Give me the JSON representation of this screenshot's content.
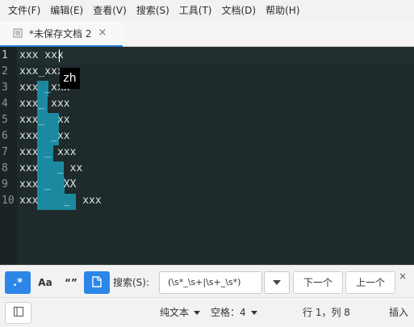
{
  "menu": [
    "文件(F)",
    "编辑(E)",
    "查看(V)",
    "搜索(S)",
    "工具(T)",
    "文档(D)",
    "帮助(H)"
  ],
  "tab": {
    "label": "*未保存文档 2",
    "close": "×"
  },
  "editor": {
    "line_numbers": [
      "1",
      "2",
      "3",
      "4",
      "5",
      "6",
      "7",
      "8",
      "9",
      "10"
    ],
    "lines": [
      "xxx xxx",
      "xxx_xxx",
      "xxx _xxx",
      "xxx_ xxx",
      "xxx_  xx",
      "xxx  _xx",
      "xxx _ xxx",
      "xxx   _ xx",
      "xxx _  XX",
      "xxx    _  xxx"
    ],
    "ime_text": "zh",
    "colors": {
      "background": "#1e2a2b",
      "selection": "#1b8aa0",
      "text": "#e2e6e6"
    }
  },
  "findbar": {
    "regex_icon": ".*",
    "case_icon": "Aa",
    "word_icon": "“”",
    "label": "搜索(S):",
    "query": "(\\s*_\\s+|\\s+_\\s*)",
    "next_label": "下一个",
    "prev_label": "上一个",
    "close": "×"
  },
  "statusbar": {
    "syntax": "纯文本",
    "indent": "空格：4",
    "position": "行 1，列 8",
    "mode": "插入"
  }
}
